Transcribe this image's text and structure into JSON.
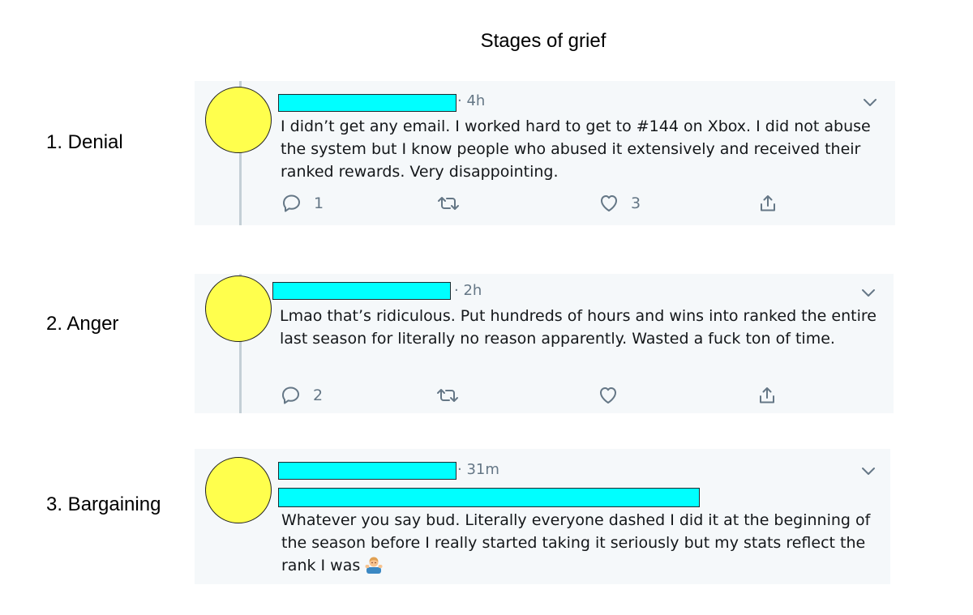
{
  "title": "Stages of grief",
  "colors": {
    "card_background": "#f5f8fa",
    "avatar_fill": "#ffff4d",
    "redaction_fill": "#00ffff",
    "secondary_text": "#657786",
    "thread_line": "#c4cfd6"
  },
  "stages": [
    {
      "label": "1. Denial",
      "tweet": {
        "timestamp": "· 4h",
        "text": "I didn’t get any email. I worked hard to get to #144 on Xbox. I did not abuse the system but I know people who abused it extensively and received their ranked rewards. Very disappointing.",
        "reply_count": "1",
        "retweet_count": "",
        "like_count": "3"
      }
    },
    {
      "label": "2. Anger",
      "tweet": {
        "timestamp": "· 2h",
        "text": "Lmao that’s ridiculous. Put hundreds of hours and wins into ranked the entire last season for literally no reason apparently. Wasted a fuck ton of time.",
        "reply_count": "2",
        "retweet_count": "",
        "like_count": ""
      }
    },
    {
      "label": "3. Bargaining",
      "tweet": {
        "timestamp": "· 31m",
        "text": "Whatever you say bud. Literally everyone dashed I did it at the beginning of the season before I really started taking it seriously but my stats reflect the rank I was",
        "emoji": "man-shrugging-emoji"
      }
    }
  ]
}
